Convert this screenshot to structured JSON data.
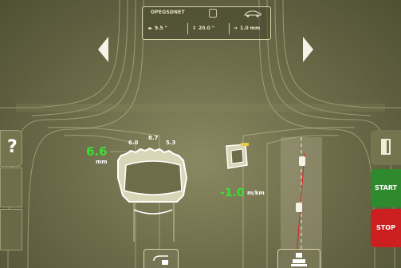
{
  "header": {
    "vehicle_label": "OPEGSDNET",
    "values": {
      "left": "9.5 \"",
      "middle": "20.0 \"",
      "right": "1.0 mm"
    }
  },
  "nav": {
    "left_arrow": "left-arrow",
    "right_arrow": "right-arrow"
  },
  "left_panel": {
    "help_label": "?"
  },
  "tread": {
    "main_value": "6.6",
    "main_unit": "mm",
    "values": [
      "6.0",
      "8.7",
      "5.3"
    ]
  },
  "toe": {
    "value": "-1.0",
    "unit": "m/km"
  },
  "buttons": {
    "start": "START",
    "stop": "STOP"
  },
  "icons": {
    "question": "help-icon",
    "exit": "exit-icon",
    "tire_print": "tire-print-icon",
    "lift": "lift-icon"
  },
  "colors": {
    "accent_green": "#39e232",
    "start_green": "#2f8a2e",
    "stop_red": "#cc1f1f",
    "panel_olive": "#6e6d4a"
  }
}
